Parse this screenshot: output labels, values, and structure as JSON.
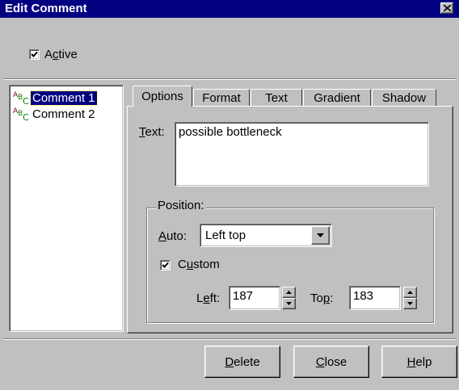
{
  "window": {
    "title": "Edit Comment"
  },
  "active": {
    "label_pre": "A",
    "label_ul": "c",
    "label_post": "tive",
    "checked": true
  },
  "tree": {
    "items": [
      {
        "label": "Comment 1",
        "selected": true
      },
      {
        "label": "Comment 2",
        "selected": false
      }
    ]
  },
  "tabs": [
    {
      "label": "Options",
      "active": true
    },
    {
      "label": "Format",
      "active": false
    },
    {
      "label": "Text",
      "active": false
    },
    {
      "label": "Gradient",
      "active": false
    },
    {
      "label": "Shadow",
      "active": false
    }
  ],
  "options": {
    "text_label_ul": "T",
    "text_label_post": "ext:",
    "text_value": "possible bottleneck",
    "position": {
      "group_label": "Position:",
      "auto_label_ul": "A",
      "auto_label_post": "uto:",
      "auto_value": "Left top",
      "custom_label_pre": "C",
      "custom_label_ul": "u",
      "custom_label_post": "stom",
      "custom_checked": true,
      "left_label_pre": "L",
      "left_label_ul": "e",
      "left_label_post": "ft:",
      "left_value": "187",
      "top_label_pre": "To",
      "top_label_ul": "p",
      "top_label_post": ":",
      "top_value": "183"
    }
  },
  "buttons": {
    "delete_ul": "D",
    "delete_post": "elete",
    "close_ul": "C",
    "close_post": "lose",
    "help_ul": "H",
    "help_post": "elp"
  },
  "icons": {
    "close": "close-icon",
    "check": "checkmark-icon",
    "comment": "text-abc-icon",
    "dropdown": "chevron-down-icon",
    "spin_up": "triangle-up-icon",
    "spin_down": "triangle-down-icon"
  },
  "colors": {
    "titlebar": "#000080",
    "face": "#c0c0c0",
    "selection": "#000080",
    "icon_green": "#008000"
  }
}
